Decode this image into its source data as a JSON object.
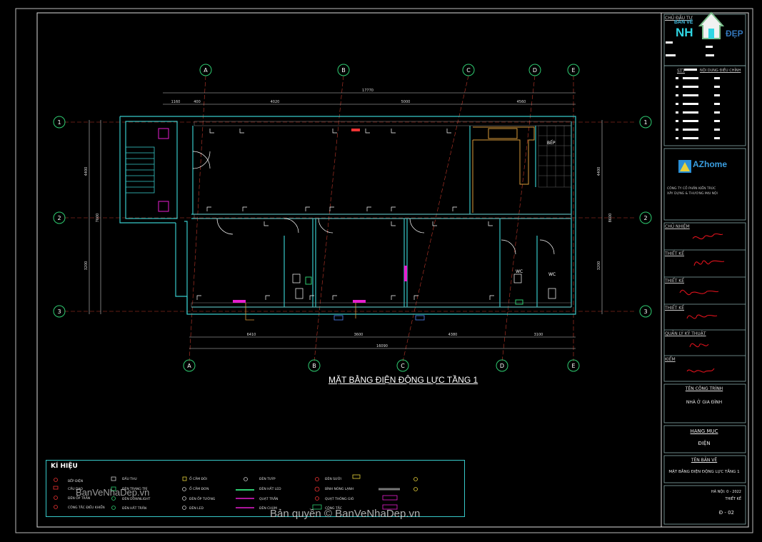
{
  "plan": {
    "title": "MẶT BẰNG ĐIỆN ĐỘNG LỰC TẦNG 1",
    "axis_letters_top": [
      "A",
      "B",
      "C",
      "D",
      "E"
    ],
    "axis_letters_bottom": [
      "A",
      "B",
      "C",
      "D",
      "E"
    ],
    "axis_numbers_left": [
      "1",
      "2",
      "3"
    ],
    "axis_numbers_right": [
      "1",
      "2",
      "3"
    ],
    "dim_top_total": "17770",
    "dim_top_segments": [
      "1160",
      "400",
      "4020",
      "5000",
      "4560"
    ],
    "dim_bottom_total": "16090",
    "dim_bottom_segments": [
      "6410",
      "3600",
      "4380",
      "3100"
    ],
    "dim_left": [
      "4400",
      "7600",
      "3200"
    ],
    "dim_right": [
      "4400",
      "8600",
      "3200"
    ],
    "room_labels": [
      "WC",
      "WC",
      "BẾP"
    ]
  },
  "legend": {
    "title": "KÍ HIỆU",
    "items": [
      "BẾP ĐIỆN",
      "CẦU DAO",
      "ĐÈN ỐP TRẦN",
      "CÔNG TẮC ĐIỀU KHIỂN",
      "ĐẦU THU",
      "ĐÈN TRANG TRÍ",
      "ĐÈN DOWNLIGHT",
      "ĐÈN HẮT TRẦN",
      "Ổ CẮM ĐÔI",
      "Ổ CẮM ĐƠN",
      "ĐÈN ỐP TƯỜNG",
      "ĐÈN LED",
      "ĐÈN TUÝP",
      "ĐÈN HẮT LED",
      "QUẠT TRẦN",
      "ĐÈN CHÙM",
      "ĐÈN SƯỞI",
      "BÌNH NÓNG LẠNH",
      "QUẠT THÔNG GIÓ",
      "CÔNG TẮC"
    ]
  },
  "title_block": {
    "chu_dau_tu_label": "CHỦ ĐẦU TƯ",
    "logo_top": "BẢN VẼ",
    "logo_nh": "NH",
    "logo_dep": "ĐẸP",
    "stt_label": "STT",
    "revision_label": "NỘI DUNG ĐIỀU CHỈNH",
    "company_brand": "AZhome",
    "company_line1": "CÔNG TY CỔ PHẦN KIẾN TRÚC",
    "company_line2": "XÂY DỰNG & THƯƠNG MẠI NỘI",
    "chu_nhiem_label": "CHỦ NHIỆM",
    "thiet_ke_label_1": "THIẾT KẾ",
    "thiet_ke_label_2": "THIẾT KẾ",
    "thiet_ke_label_3": "THIẾT KẾ",
    "quan_ly_label": "QUẢN LÝ KỸ THUẬT",
    "kiem_label": "KIỂM",
    "ten_cong_trinh_label": "TÊN CÔNG TRÌNH",
    "ten_cong_trinh_value": "NHÀ Ở GIA ĐÌNH",
    "hang_muc_label": "HẠNG MỤC",
    "hang_muc_value": "ĐIỆN",
    "ten_ban_ve_label": "TÊN BẢN VẼ",
    "ten_ban_ve_value": "MẶT BẰNG ĐIỆN ĐỘNG LỰC TẦNG 1",
    "ha_noi": "HÀ NỘI: 0 - 2022",
    "thiet_ke_small": "THIẾT KẾ",
    "sheet_no": "Đ - 02"
  },
  "watermark": {
    "main": "Bản quyền © BanVeNhaDep.vn",
    "small": "BanVeNhaDep.vn"
  },
  "colors": {
    "background": "#000000",
    "frame": "#c8c8c8",
    "wall": "#37c9c9",
    "grid_red": "#c0392b",
    "axis_circle": "#2ecc71",
    "switch_magenta": "#e61ecf",
    "cabinet_orange": "#d99a3a"
  }
}
